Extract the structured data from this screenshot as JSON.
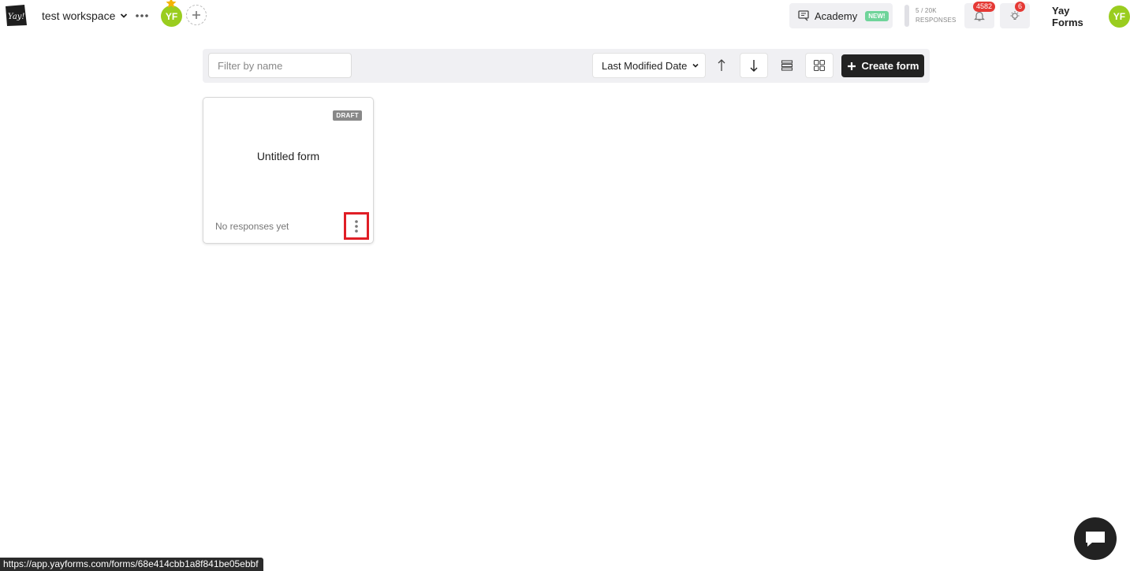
{
  "topbar": {
    "logo_text": "Yay!",
    "workspace_name": "test workspace",
    "workspace_avatar_initials": "YF",
    "academy_label": "Academy",
    "academy_badge": "NEW!",
    "responses_usage": "5 / 20K",
    "responses_label": "RESPONSES",
    "notifications_count": "4582",
    "whats_new_count": "6",
    "account_name": "Yay Forms",
    "account_avatar_initials": "YF"
  },
  "toolbar": {
    "filter_placeholder": "Filter by name",
    "filter_value": "",
    "sort_by": "Last Modified Date",
    "sort_direction": "descending",
    "view_mode": "grid",
    "create_label": "Create form"
  },
  "forms": [
    {
      "title": "Untitled form",
      "status_badge": "DRAFT",
      "responses_text": "No responses yet"
    }
  ],
  "status_url": "https://app.yayforms.com/forms/68e414cbb1a8f841be05ebbf",
  "colors": {
    "avatar": "#9acd1f",
    "badge_red": "#e53935",
    "new_badge": "#6fd49a",
    "primary_button": "#222222",
    "highlight_box": "#e01e26"
  },
  "icons": {
    "logo": "yayforms-logo-icon",
    "workspace_menu": "chevron-down-icon",
    "more": "more-horizontal-icon",
    "favorite": "star-icon",
    "add_member": "plus-icon",
    "academy": "academy-icon",
    "notifications": "bell-icon",
    "whats_new": "lightbulb-icon",
    "sort_asc": "arrow-up-icon",
    "sort_desc": "arrow-down-icon",
    "list_view": "list-view-icon",
    "grid_view": "grid-view-icon",
    "create": "plus-icon",
    "card_menu": "more-vertical-icon",
    "chat": "chat-icon"
  }
}
